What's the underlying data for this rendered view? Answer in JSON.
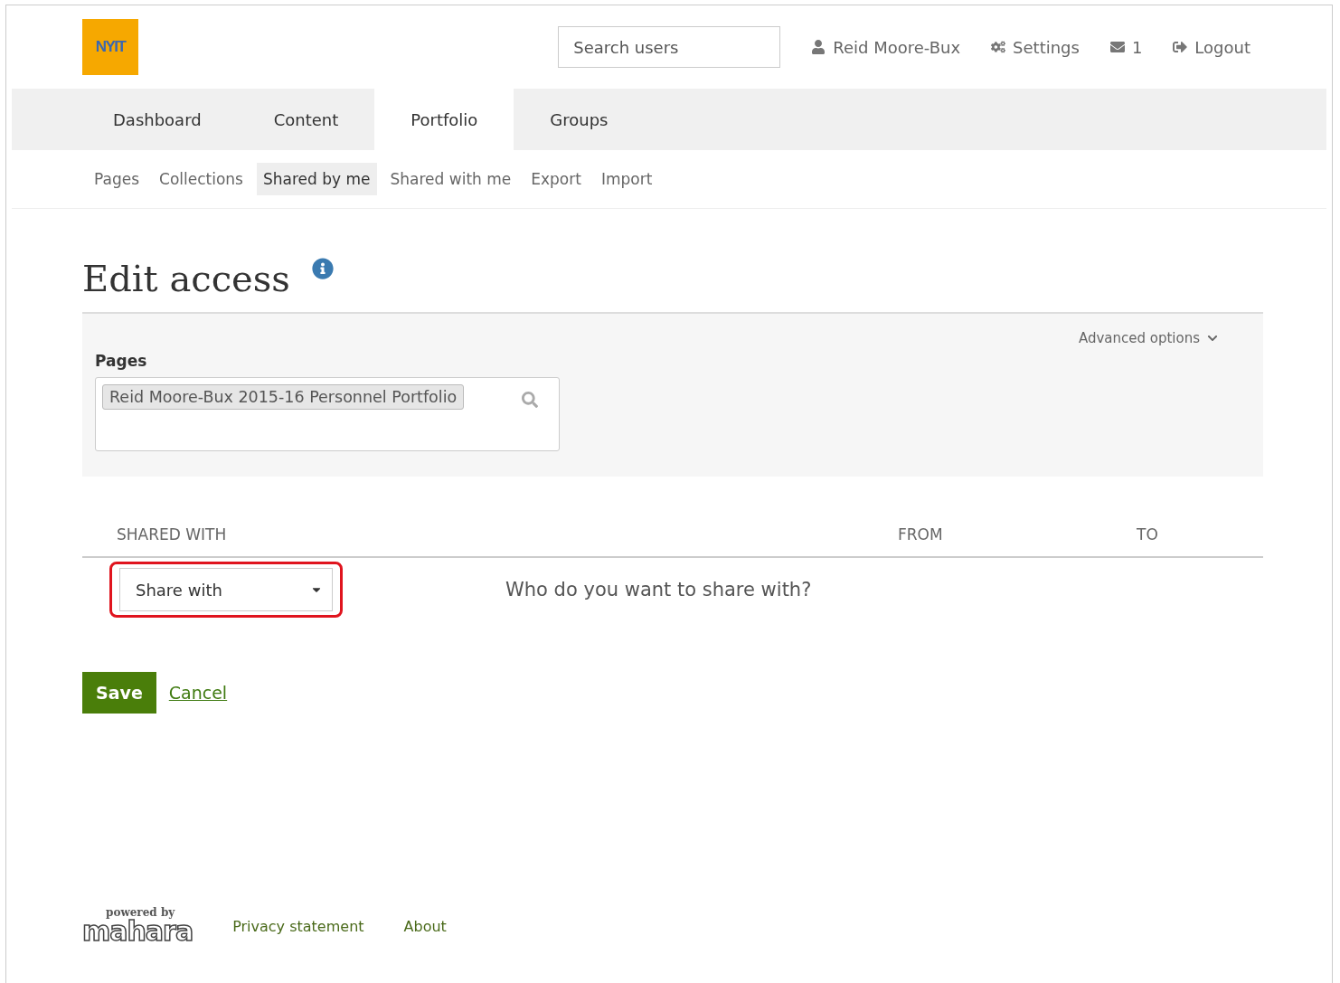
{
  "header": {
    "logo": "NYIT",
    "search": {
      "placeholder": "Search users"
    },
    "user_menu": [
      {
        "kind": "user",
        "label": "Reid Moore-Bux"
      },
      {
        "kind": "settings",
        "label": "Settings"
      },
      {
        "kind": "mail",
        "label": "1"
      },
      {
        "kind": "logout",
        "label": "Logout"
      }
    ]
  },
  "main_nav": [
    {
      "label": "Dashboard",
      "selected": false
    },
    {
      "label": "Content",
      "selected": false
    },
    {
      "label": "Portfolio",
      "selected": true
    },
    {
      "label": "Groups",
      "selected": false
    }
  ],
  "sub_nav": [
    {
      "label": "Pages",
      "selected": false
    },
    {
      "label": "Collections",
      "selected": false
    },
    {
      "label": "Shared by me",
      "selected": true
    },
    {
      "label": "Shared with me",
      "selected": false
    },
    {
      "label": "Export",
      "selected": false
    },
    {
      "label": "Import",
      "selected": false
    }
  ],
  "page_title": "Edit access",
  "panel": {
    "advanced_options": "Advanced options",
    "pages_label": "Pages",
    "selected_pages": [
      "Reid Moore-Bux 2015-16 Personnel Portfolio"
    ]
  },
  "table": {
    "columns": [
      "SHARED WITH",
      "FROM",
      "TO"
    ],
    "share_select": "Share with",
    "hint": "Who do you want to share with?",
    "highlighted": true
  },
  "buttons": {
    "save": "Save",
    "cancel": "Cancel"
  },
  "footer": {
    "logo_top": "powered by",
    "logo_main": "mahara",
    "links": [
      "Privacy statement",
      "About"
    ]
  }
}
